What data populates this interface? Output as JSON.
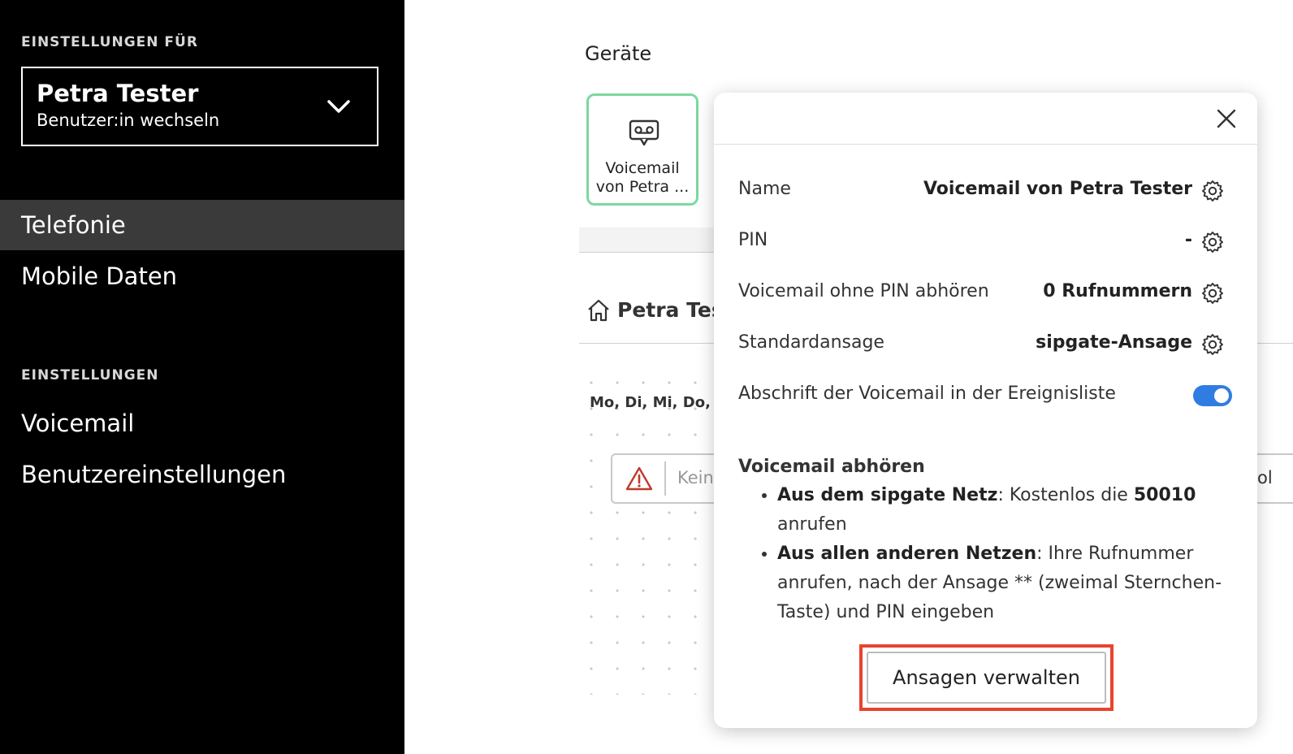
{
  "sidebar": {
    "settings_for_label": "EINSTELLUNGEN FÜR",
    "user": {
      "name": "Petra Tester",
      "switch_label": "Benutzer:in wechseln"
    },
    "nav": [
      {
        "label": "Telefonie",
        "active": true
      },
      {
        "label": "Mobile Daten",
        "active": false
      }
    ],
    "settings_label": "EINSTELLUNGEN",
    "settings_items": [
      {
        "label": "Voicemail"
      },
      {
        "label": "Benutzereinstellungen"
      }
    ]
  },
  "main": {
    "section_title": "Geräte",
    "device": {
      "label_line1": "Voicemail",
      "label_line2": "von Petra ..."
    },
    "home_label": "Petra Test",
    "days": "Mo, Di, Mi, Do, Fr",
    "warning_text": "Kein",
    "right_fragment": "ol"
  },
  "popover": {
    "rows": [
      {
        "label": "Name",
        "value": "Voicemail von Petra Tester"
      },
      {
        "label": "PIN",
        "value": "-"
      },
      {
        "label": "Voicemail ohne PIN abhören",
        "value": "0 Rufnummern"
      },
      {
        "label": "Standardansage",
        "value": "sipgate-Ansage"
      }
    ],
    "transcript_label": "Abschrift der Voicemail in der Ereignisliste",
    "transcript_enabled": true,
    "listen": {
      "heading": "Voicemail abhören",
      "item1": {
        "bold": "Aus dem sipgate Netz",
        "text1": ": Kostenlos die ",
        "number": "50010",
        "text2": " anrufen"
      },
      "item2": {
        "bold": "Aus allen anderen Netzen",
        "text": ": Ihre Rufnummer anrufen, nach der Ansage ** (zweimal Sternchen-Taste) und PIN eingeben"
      }
    },
    "manage_button": "Ansagen verwalten"
  },
  "colors": {
    "accent": "#2f7de1",
    "highlight": "#e8432e",
    "device_border": "#7dd8a0",
    "sidebar_bg": "#000000",
    "nav_active_bg": "#3a3a3a"
  }
}
